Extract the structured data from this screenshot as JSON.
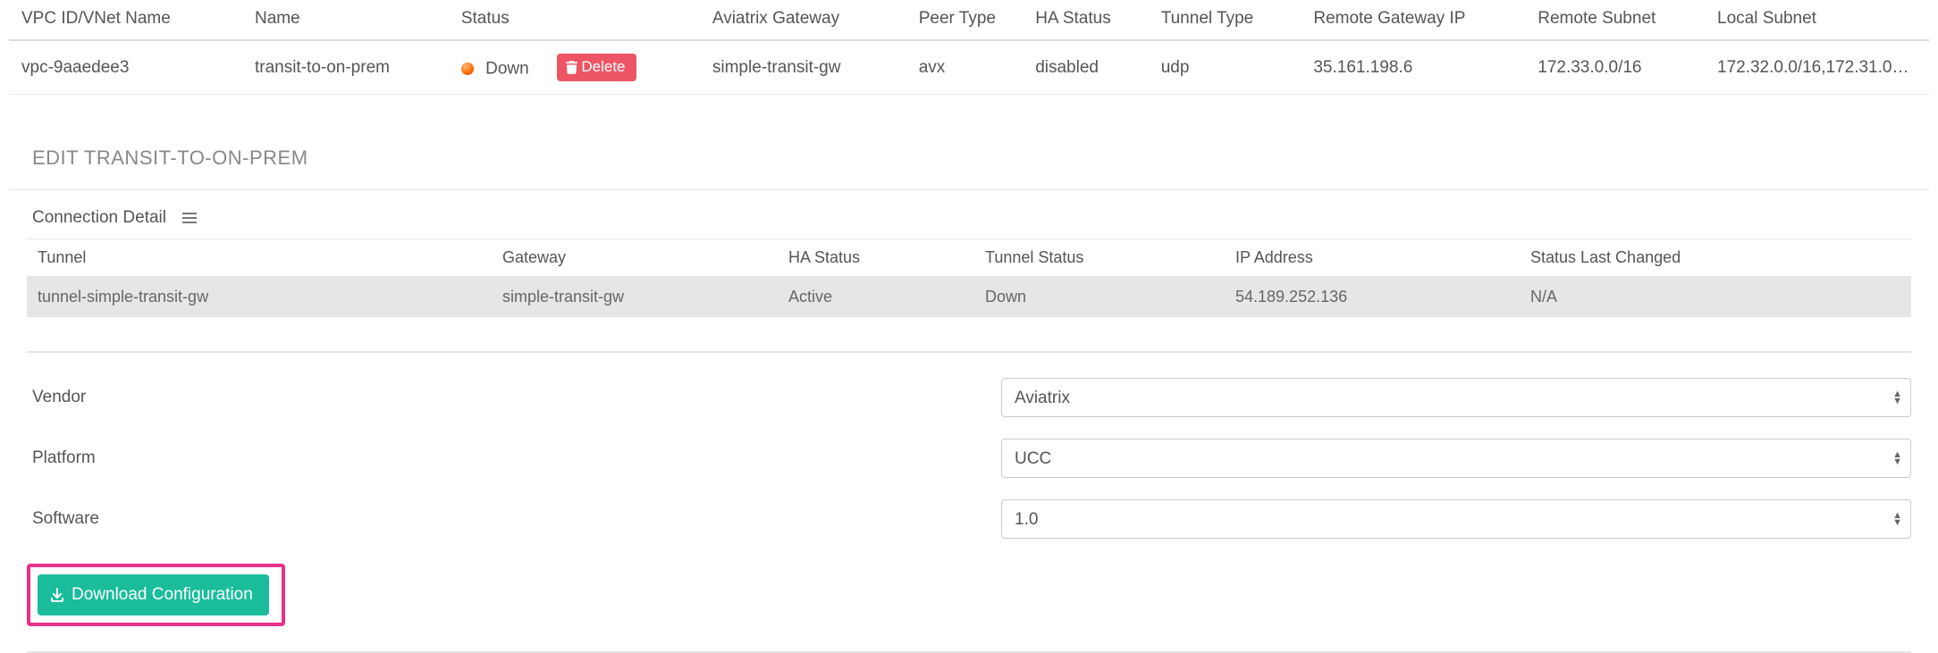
{
  "top_table": {
    "headers": {
      "vpc": "VPC ID/VNet Name",
      "name": "Name",
      "status": "Status",
      "agw": "Aviatrix Gateway",
      "peer": "Peer Type",
      "ha": "HA Status",
      "tt": "Tunnel Type",
      "rip": "Remote Gateway IP",
      "rs": "Remote Subnet",
      "ls": "Local Subnet"
    },
    "row": {
      "vpc": "vpc-9aaedee3",
      "name": "transit-to-on-prem",
      "status_text": "Down",
      "delete_label": "Delete",
      "agw": "simple-transit-gw",
      "peer": "avx",
      "ha": "disabled",
      "tt": "udp",
      "rip": "35.161.198.6",
      "rs": "172.33.0.0/16",
      "ls": "172.32.0.0/16,172.31.0…"
    }
  },
  "edit": {
    "title": "EDIT TRANSIT-TO-ON-PREM",
    "connection_detail_label": "Connection Detail",
    "detail_headers": {
      "tunnel": "Tunnel",
      "gateway": "Gateway",
      "ha": "HA Status",
      "ts": "Tunnel Status",
      "ip": "IP Address",
      "last": "Status Last Changed"
    },
    "detail_row": {
      "tunnel": "tunnel-simple-transit-gw",
      "gateway": "simple-transit-gw",
      "ha": "Active",
      "ts": "Down",
      "ip": "54.189.252.136",
      "last": "N/A"
    }
  },
  "form": {
    "vendor_label": "Vendor",
    "vendor_value": "Aviatrix",
    "platform_label": "Platform",
    "platform_value": "UCC",
    "software_label": "Software",
    "software_value": "1.0"
  },
  "download_label": "Download Configuration"
}
